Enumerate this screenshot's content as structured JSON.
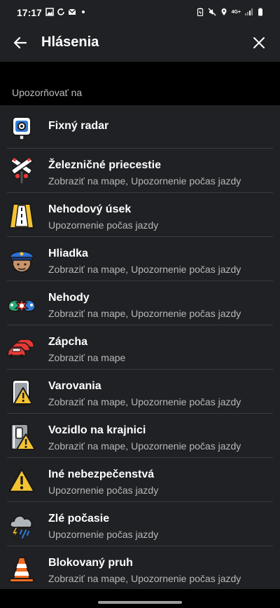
{
  "status_bar": {
    "time": "17:17",
    "network_label": "4G+"
  },
  "app_bar": {
    "title": "Hlásenia"
  },
  "section": {
    "header": "Upozorňovať na"
  },
  "items": [
    {
      "label": "Fixný radar",
      "subtitle": "",
      "icon": "speed-camera-icon"
    },
    {
      "label": "Železničné priecestie",
      "subtitle": "Zobraziť na mape, Upozornenie počas jazdy",
      "icon": "railroad-crossing-icon"
    },
    {
      "label": "Nehodový úsek",
      "subtitle": "Upozornenie počas jazdy",
      "icon": "hazard-road-icon"
    },
    {
      "label": "Hliadka",
      "subtitle": "Zobraziť na mape, Upozornenie počas jazdy",
      "icon": "police-icon"
    },
    {
      "label": "Nehody",
      "subtitle": "Zobraziť na mape, Upozornenie počas jazdy",
      "icon": "crash-icon"
    },
    {
      "label": "Zápcha",
      "subtitle": "Zobraziť na mape",
      "icon": "traffic-jam-icon"
    },
    {
      "label": "Varovania",
      "subtitle": "Zobraziť na mape, Upozornenie počas jazdy",
      "icon": "warning-phone-icon"
    },
    {
      "label": "Vozidlo na krajnici",
      "subtitle": "Zobraziť na mape, Upozornenie počas jazdy",
      "icon": "vehicle-on-shoulder-icon"
    },
    {
      "label": "Iné nebezpečenstvá",
      "subtitle": "Upozornenie počas jazdy",
      "icon": "hazard-triangle-icon"
    },
    {
      "label": "Zlé počasie",
      "subtitle": "Upozornenie počas jazdy",
      "icon": "storm-cloud-icon"
    },
    {
      "label": "Blokovaný pruh",
      "subtitle": "Zobraziť na mape, Upozornenie počas jazdy",
      "icon": "traffic-cone-icon"
    }
  ]
}
